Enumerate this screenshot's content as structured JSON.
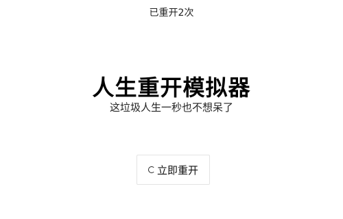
{
  "header": {
    "restart_count_text": "已重开2次"
  },
  "main": {
    "title": "人生重开模拟器",
    "subtitle": "这垃圾人生一秒也不想呆了"
  },
  "restart_button": {
    "label": "立即重开",
    "icon": "loading-spinner-icon"
  }
}
